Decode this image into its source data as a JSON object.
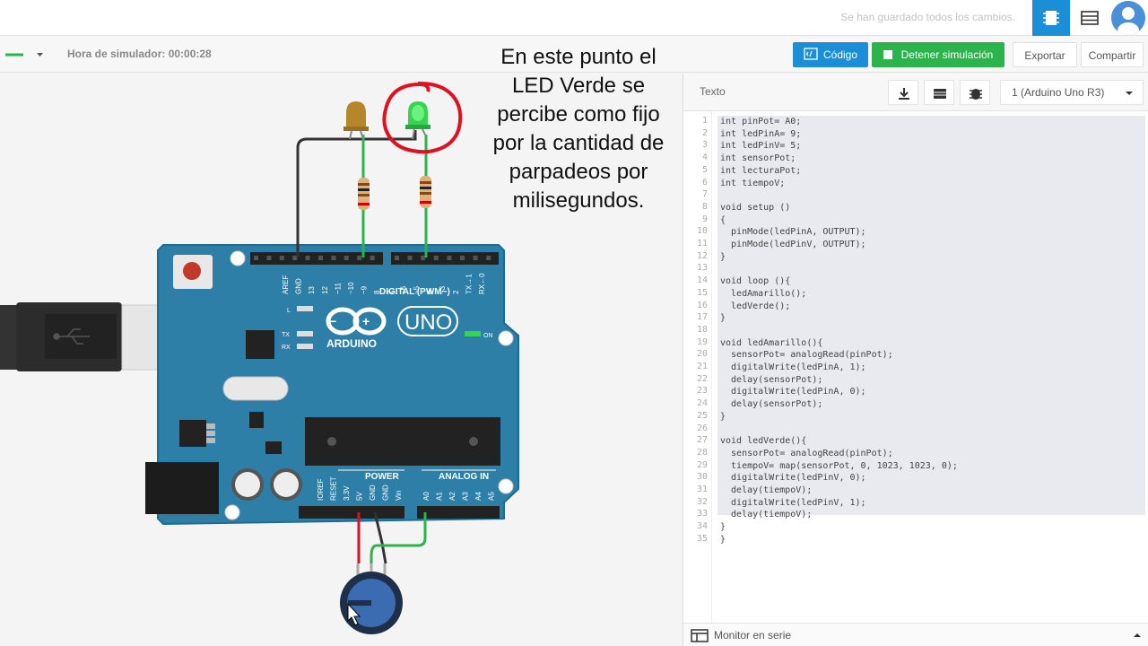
{
  "topbar": {
    "saved_status": "Se han guardado todos los cambios.",
    "icons": [
      "components-icon",
      "list-icon",
      "user-avatar-icon"
    ]
  },
  "toolbar": {
    "sim_time": "Hora de simulador: 00:00:28",
    "code_label": "Código",
    "stop_label": "Detener simulación",
    "export_label": "Exportar",
    "share_label": "Compartir"
  },
  "annotation": {
    "text_lines": [
      "En este punto el",
      "LED Verde se",
      "percibe como fijo",
      "por la cantidad de",
      "parpadeos por",
      "milisegundos."
    ]
  },
  "board": {
    "brand": "ARDUINO",
    "model": "UNO",
    "digital_label": "DIGITAL (PWM~)",
    "power_label": "POWER",
    "analog_label": "ANALOG IN",
    "on_label": "ON",
    "l_label": "L",
    "tx_label": "TX",
    "rx_label": "RX",
    "digital_pins": [
      "AREF",
      "GND",
      "13",
      "12",
      "~11",
      "~10",
      "~9",
      "8",
      "7",
      "~6",
      "~5",
      "4",
      "~3",
      "2",
      "TX→1",
      "RX←0"
    ],
    "power_pins": [
      "IOREF",
      "RESET",
      "3.3V",
      "5V",
      "GND",
      "GND",
      "Vin"
    ],
    "analog_pins": [
      "A0",
      "A1",
      "A2",
      "A3",
      "A4",
      "A5"
    ]
  },
  "code_panel": {
    "mode": "Texto",
    "board_select": "1 (Arduino Uno R3)",
    "serial_monitor": "Monitor en serie",
    "lines": [
      "int pinPot= A0;",
      "int ledPinA= 9;",
      "int ledPinV= 5;",
      "int sensorPot;",
      "int lecturaPot;",
      "int tiempoV;",
      "",
      "void setup ()",
      "{",
      "  pinMode(ledPinA, OUTPUT);",
      "  pinMode(ledPinV, OUTPUT);",
      "}",
      "",
      "void loop (){",
      "  ledAmarillo();",
      "  ledVerde();",
      "}",
      "",
      "void ledAmarillo(){",
      "  sensorPot= analogRead(pinPot);",
      "  digitalWrite(ledPinA, 1);",
      "  delay(sensorPot);",
      "  digitalWrite(ledPinA, 0);",
      "  delay(sensorPot);",
      "}",
      "",
      "void ledVerde(){",
      "  sensorPot= analogRead(pinPot);",
      "  tiempoV= map(sensorPot, 0, 1023, 1023, 0);",
      "  digitalWrite(ledPinV, 0);",
      "  delay(tiempoV);",
      "  digitalWrite(ledPinV, 1);",
      "  delay(tiempoV);",
      "}"
    ]
  },
  "colors": {
    "accent_blue": "#1a8fd8",
    "stop_green": "#2bb34c",
    "board_blue": "#2d7fa8",
    "annotation_red": "#e0101e",
    "led_green": "#39d353",
    "led_yellow": "#b5862a"
  }
}
